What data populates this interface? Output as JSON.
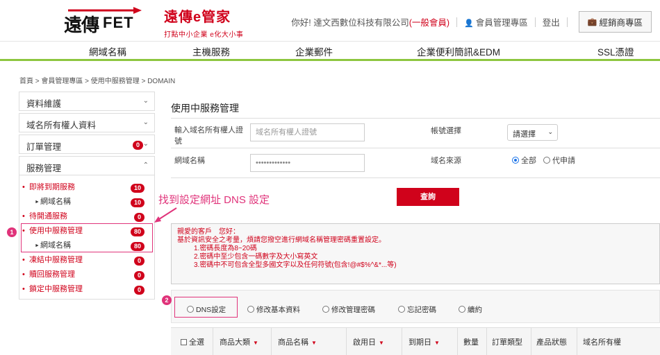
{
  "header": {
    "logo_cn": "遠傳",
    "logo_en": "FET",
    "brand_title": "遠傳e管家",
    "brand_slogan": "打點中小企業 e化大小事",
    "greeting": "你好! 達文西數位科技有限公司",
    "member_level": "(一般會員)",
    "member_area": "會員管理專區",
    "logout": "登出",
    "dealer_area": "經銷商專區"
  },
  "nav": {
    "items": [
      "網域名稱",
      "主機服務",
      "企業郵件",
      "企業便利簡訊&EDM",
      "SSL憑證"
    ]
  },
  "breadcrumb": "首頁 > 會員管理專區 > 使用中服務管理 > DOMAIN",
  "sidebar": {
    "sections": [
      {
        "label": "資料維護"
      },
      {
        "label": "域名所有權人資料"
      },
      {
        "label": "訂單管理",
        "badge": "0"
      },
      {
        "label": "服務管理"
      }
    ],
    "items": [
      {
        "label": "即將到期服務",
        "badge": "10"
      },
      {
        "label": "網域名稱",
        "badge": "10"
      },
      {
        "label": "待開通服務",
        "badge": "0"
      },
      {
        "label": "使用中服務管理",
        "badge": "80"
      },
      {
        "label": "網域名稱",
        "badge": "80"
      },
      {
        "label": "凍結中服務管理",
        "badge": "0"
      },
      {
        "label": "贖回服務管理",
        "badge": "0"
      },
      {
        "label": "鎖定中服務管理",
        "badge": "0"
      }
    ]
  },
  "annotation": {
    "step1": "1",
    "step2": "2",
    "hint": "找到設定網址 DNS 設定"
  },
  "main": {
    "title": "使用中服務管理",
    "owner_id_label": "輸入域名所有權人證號",
    "owner_id_placeholder": "域名所有權人證號",
    "account_label": "帳號選擇",
    "account_select": "請選擇",
    "domain_label": "網域名稱",
    "domain_value": "•••••••••••••",
    "source_label": "域名來源",
    "source_options": [
      "全部",
      "代申請"
    ],
    "query_button": "查詢"
  },
  "notice": {
    "line1": "親愛的客戶　您好：",
    "line2": "基於資訊安全之考量，煩請您撥空進行網域名稱管理密碼重置設定。",
    "rules": [
      "1.密碼長度為8~20碼",
      "2.密碼中至少包含一碼數字及大小寫英文",
      "3.密碼中不可包含全型多國文字以及任何符號(包含!@#$%^&*...等)"
    ]
  },
  "action_tabs": [
    "DNS設定",
    "修改基本資料",
    "修改管理密碼",
    "忘記密碼",
    "續約"
  ],
  "table": {
    "headers": [
      "全選",
      "商品大類",
      "商品名稱",
      "啟用日",
      "到期日",
      "數量",
      "訂單類型",
      "產品狀態",
      "域名所有權"
    ]
  },
  "colors": {
    "accent_red": "#d0021b",
    "annotation_pink": "#e0337a",
    "nav_green": "#8dc63f"
  }
}
